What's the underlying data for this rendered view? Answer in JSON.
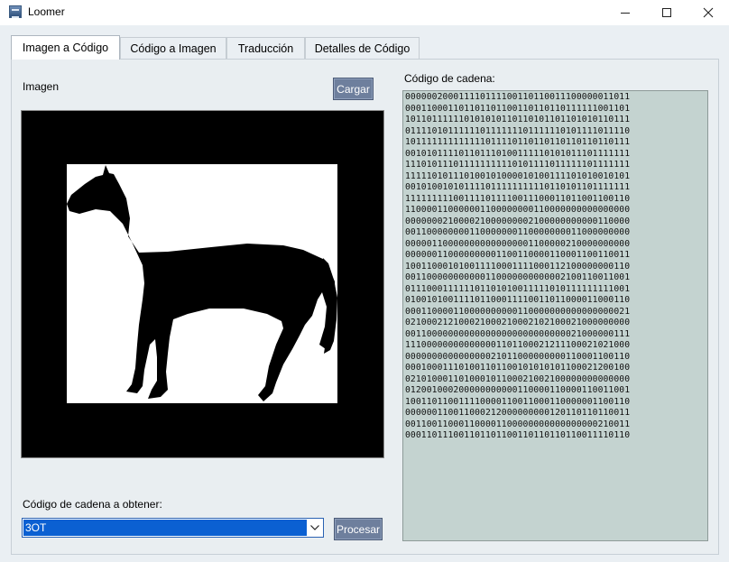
{
  "window": {
    "title": "Loomer",
    "icon": "app-window-icon",
    "controls": {
      "minimize": "minimize-icon",
      "maximize": "maximize-icon",
      "close": "close-icon"
    }
  },
  "tabs": [
    {
      "label": "Imagen a Código",
      "active": true
    },
    {
      "label": "Código a Imagen",
      "active": false
    },
    {
      "label": "Traducción",
      "active": false
    },
    {
      "label": "Detalles de Código",
      "active": false
    }
  ],
  "main": {
    "image_label": "Imagen",
    "load_button": "Cargar",
    "chain_label": "Código de cadena:",
    "obtain_label": "Código de cadena a obtener:",
    "selected_option": "3OT",
    "process_button": "Procesar",
    "code_lines": [
      "000000200011110111100110110011100000011011",
      "000110001101101101100110110110111111001101",
      "101101111110101010110110101101101010110111",
      "011110101111110111111101111110101111011110",
      "101111111111111011110110110110110110110111",
      "001010111101101110100111110101011101111111",
      "111010111011111111110101111011111101111111",
      "111110101110100101000010100111101010010101",
      "001010010101111011111111110110101101111111",
      "111111111001111011110011100011011001100110",
      "110000110000001100000000110000000000000000",
      "000000021000021000000002100000000000110000",
      "001100000000110000000110000000011000000000",
      "000001100000000000000001100000210000000000",
      "000000110000000001100110000110001100110011",
      "100110001010011110001111000112100000000110",
      "001100000000000110000000000002100110011001",
      "011100011111101101010011111010111111111001",
      "010010100111101100011110011011000011000110",
      "000110000110000000000110000000000000000021",
      "021000212100021000210002102100021000000000",
      "001100000000000000000000000000021000000111",
      "111000000000000001101100021211100021021000",
      "000000000000000021011000000000110001100110",
      "000100011101001101100101010101100021200100",
      "021010001101000101100021002100000000000000",
      "012001000200000000000110000110000110011001",
      "100110110011110000110011000110000001100110",
      "000000110011000212000000000120110110110011",
      "001100110001100001100000000000000000210011",
      "000110111001101101100110110110110011110110"
    ]
  },
  "colors": {
    "button_bg": "#6e7f9d",
    "code_bg": "#c4d3d0",
    "selection": "#0b60d2",
    "panel_bg": "#e9eef1"
  }
}
